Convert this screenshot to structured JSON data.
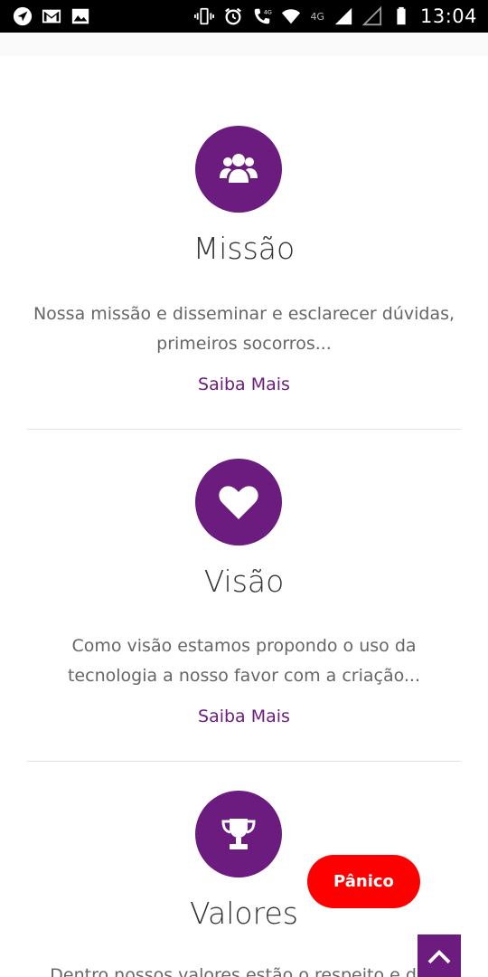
{
  "status_bar": {
    "time": "13:04",
    "network_label": "4G",
    "call_label": "4G",
    "icons": [
      "navigation-icon",
      "gmail-icon",
      "image-icon",
      "vibrate-icon",
      "alarm-icon",
      "wifi-call-icon",
      "wifi-icon",
      "signal-icon",
      "signal-empty-icon",
      "battery-icon"
    ]
  },
  "sections": [
    {
      "icon": "users-icon",
      "title": "Missão",
      "text": "Nossa missão e disseminar e esclarecer dúvidas, primeiros socorros...",
      "link": "Saiba Mais"
    },
    {
      "icon": "heart-icon",
      "title": "Visão",
      "text": "Como visão estamos propondo o uso da tecnologia a nosso favor com a criação...",
      "link": "Saiba Mais"
    },
    {
      "icon": "trophy-icon",
      "title": "Valores",
      "text": "Dentro nossos valores estão o respeito e dim"
    }
  ],
  "panic_button": "Pânico",
  "colors": {
    "accent": "#6c1b7f",
    "panic": "#ff0000",
    "status_bar": "#000000"
  }
}
